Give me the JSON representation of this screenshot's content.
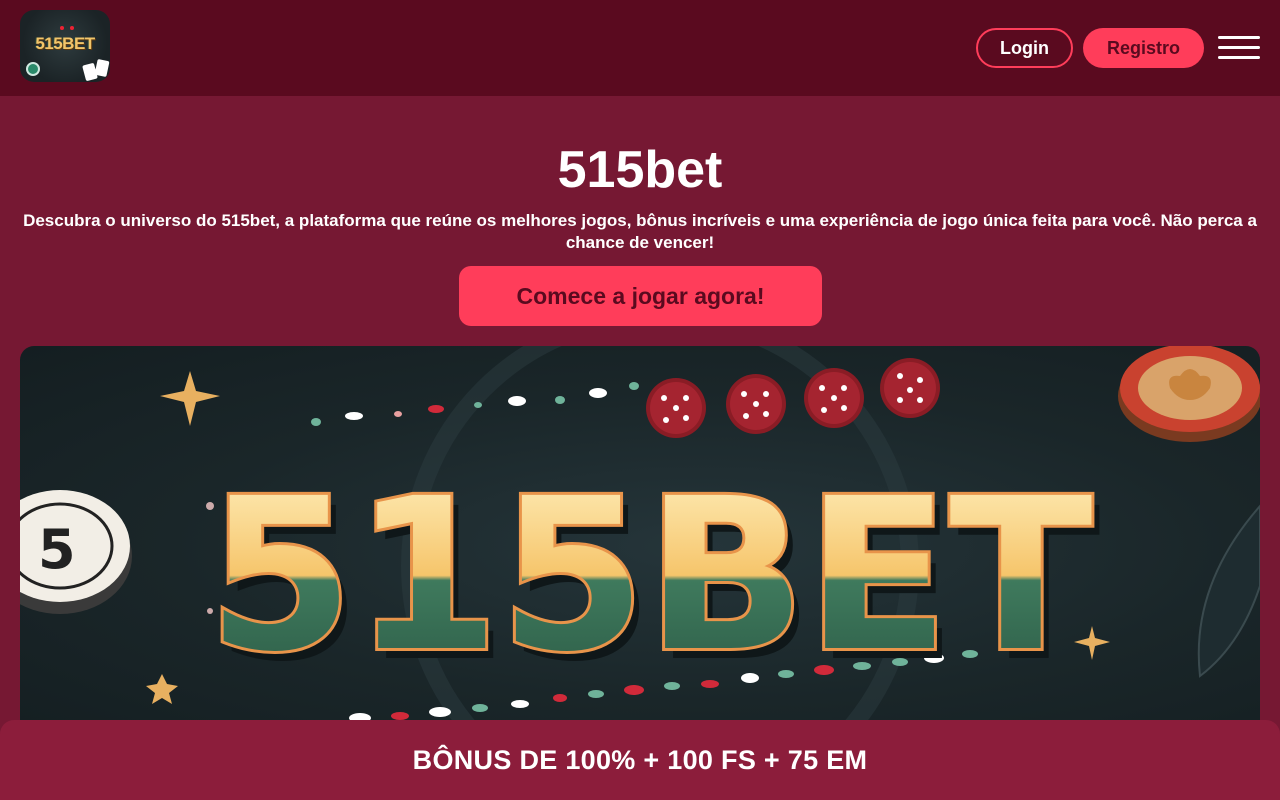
{
  "header": {
    "logo_text": "515BET",
    "login_label": "Login",
    "register_label": "Registro",
    "menu_icon": "hamburger-menu-icon"
  },
  "hero": {
    "title": "515bet",
    "description": "Descubra o universo do 515bet, a plataforma que reúne os melhores jogos, bônus incríveis e uma experiência de jogo única feita para você. Não perca a chance de vencer!",
    "cta_label": "Comece a jogar agora!"
  },
  "banner": {
    "text": "515BET"
  },
  "bonus_bar": {
    "text": "BÔNUS DE 100% + 100 FS + 75 EM"
  },
  "colors": {
    "header_bg": "#5a0a1f",
    "page_bg": "#761833",
    "accent": "#ff3d5a",
    "bonus_bg": "#8c1d3b"
  }
}
